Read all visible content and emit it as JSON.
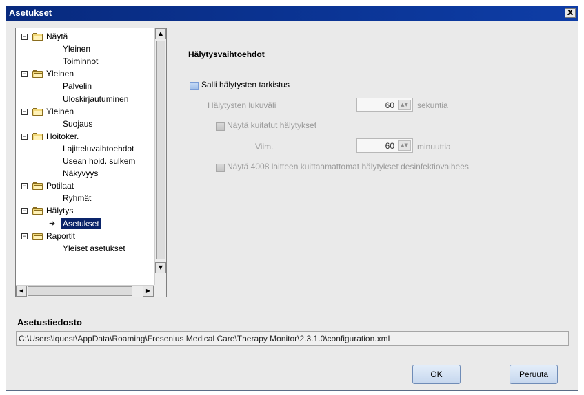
{
  "window": {
    "title": "Asetukset",
    "close_label": "X"
  },
  "tree": {
    "items": [
      {
        "label": "Näytä",
        "type": "folder",
        "expanded": true
      },
      {
        "label": "Yleinen",
        "type": "leaf"
      },
      {
        "label": "Toiminnot",
        "type": "leaf"
      },
      {
        "label": "Yleinen",
        "type": "folder",
        "expanded": true
      },
      {
        "label": "Palvelin",
        "type": "leaf"
      },
      {
        "label": "Uloskirjautuminen",
        "type": "leaf"
      },
      {
        "label": "Yleinen",
        "type": "folder",
        "expanded": true
      },
      {
        "label": "Suojaus",
        "type": "leaf"
      },
      {
        "label": "Hoitoker.",
        "type": "folder",
        "expanded": true
      },
      {
        "label": "Lajitteluvaihtoehdot",
        "type": "leaf"
      },
      {
        "label": "Usean hoid. sulkem",
        "type": "leaf"
      },
      {
        "label": "Näkyvyys",
        "type": "leaf"
      },
      {
        "label": "Potilaat",
        "type": "folder",
        "expanded": true
      },
      {
        "label": "Ryhmät",
        "type": "leaf"
      },
      {
        "label": "Hälytys",
        "type": "folder",
        "expanded": true
      },
      {
        "label": "Asetukset",
        "type": "leaf",
        "selected": true
      },
      {
        "label": "Raportit",
        "type": "folder",
        "expanded": true
      },
      {
        "label": "Yleiset asetukset",
        "type": "leaf"
      }
    ],
    "expander_symbol": "−",
    "selected_arrow": "➜"
  },
  "settings": {
    "section_title": "Hälytysvaihtoehdot",
    "allow_check": {
      "label": "Salli hälytysten tarkistus",
      "checked": false
    },
    "interval": {
      "label": "Hälytysten lukuväli",
      "value": "60",
      "unit": "sekuntia"
    },
    "show_ack": {
      "label": "Näytä kuitatut hälytykset",
      "checked": false
    },
    "last": {
      "label": "Viim.",
      "value": "60",
      "unit": "minuuttia"
    },
    "show_unack": {
      "label": "Näytä 4008 laitteen kuittaamattomat hälytykset desinfektiovaihees",
      "checked": false
    }
  },
  "config_file": {
    "title": "Asetustiedosto",
    "path": "C:\\Users\\iquest\\AppData\\Roaming\\Fresenius Medical Care\\Therapy Monitor\\2.3.1.0\\configuration.xml"
  },
  "buttons": {
    "ok": "OK",
    "cancel": "Peruuta"
  },
  "colors": {
    "titlebar": "#0a2d88",
    "selection": "#0a246a",
    "folder": "#f2d97a"
  }
}
